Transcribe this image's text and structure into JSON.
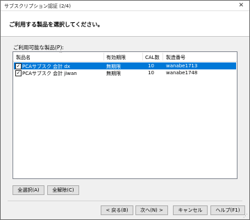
{
  "window": {
    "title": "サブスクリプション認証 (2/4)",
    "close": "✕"
  },
  "header": {
    "text": "ご利用する製品を選択してください。"
  },
  "list": {
    "label": "ご利用可能な製品(P):",
    "columns": [
      "製品名",
      "有効期限",
      "CAL数",
      "製造番号"
    ],
    "rows": [
      {
        "checked": true,
        "name": "PCAサブスク 会計 dx",
        "expiry": "無期限",
        "cal": "10",
        "serial": "wanabe1713",
        "selected": true
      },
      {
        "checked": true,
        "name": "PCAサブスク 会計 jiwan",
        "expiry": "無期限",
        "cal": "10",
        "serial": "wanabe1748",
        "selected": false
      }
    ]
  },
  "buttons": {
    "select_all": "全選択(A)",
    "clear_all": "全解除(C)",
    "back": "< 戻る(B)",
    "next": "次へ(N) >",
    "cancel": "キャンセル",
    "help": "ヘルプ(F1)"
  }
}
